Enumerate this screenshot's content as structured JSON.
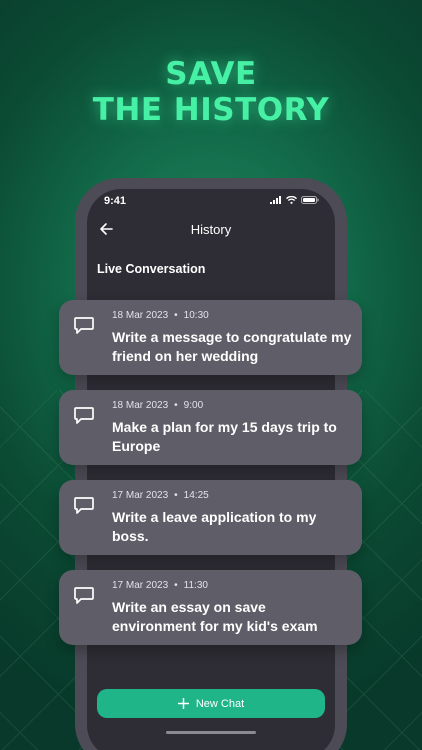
{
  "headline": {
    "line1": "SAVE",
    "line2": "THE HISTORY"
  },
  "status_bar": {
    "time": "9:41"
  },
  "nav": {
    "title": "History"
  },
  "section_title": "Live Conversation",
  "conversations": [
    {
      "date": "18 Mar 2023",
      "time": "10:30",
      "text": "Write a message to congratulate my friend on her wedding"
    },
    {
      "date": "18 Mar 2023",
      "time": "9:00",
      "text": "Make a plan for my 15 days trip to Europe"
    },
    {
      "date": "17 Mar 2023",
      "time": "14:25",
      "text": "Write a leave application to my boss."
    },
    {
      "date": "17 Mar 2023",
      "time": "11:30",
      "text": "Write an essay on save environment for my kid's exam"
    }
  ],
  "new_chat_label": "New Chat",
  "icons": {
    "back": "arrow-left-icon",
    "chat": "chat-bubble-icon",
    "plus": "plus-icon",
    "signal": "signal-icon",
    "wifi": "wifi-icon",
    "battery": "battery-icon"
  },
  "colors": {
    "accent": "#1fb589",
    "headline": "#46f0a4",
    "card": "#5f5e68",
    "screen": "#2e2d35"
  }
}
